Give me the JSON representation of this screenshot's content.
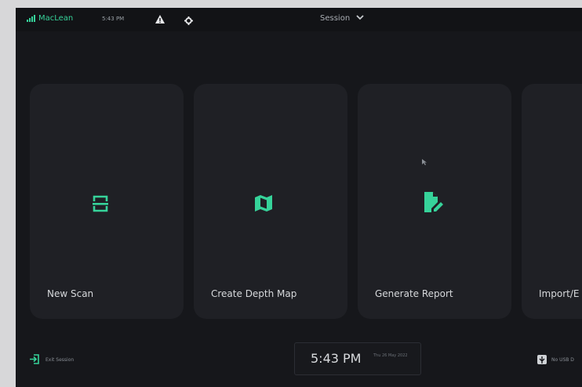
{
  "topbar": {
    "brand": "MacLean",
    "time": "5:43 PM",
    "session_label": "Session"
  },
  "cards": [
    {
      "label": "New Scan",
      "icon": "scan-icon"
    },
    {
      "label": "Create Depth Map",
      "icon": "map-icon"
    },
    {
      "label": "Generate Report",
      "icon": "report-icon"
    },
    {
      "label": "Import/E",
      "icon": "import-icon"
    }
  ],
  "bottom": {
    "exit_label": "Exit Session",
    "clock": "5:43 PM",
    "clock_sub": "Thu 26 May 2022",
    "usb_label": "No USB D"
  },
  "colors": {
    "accent": "#36d39a",
    "background": "#16171b",
    "card": "#1f2025"
  }
}
